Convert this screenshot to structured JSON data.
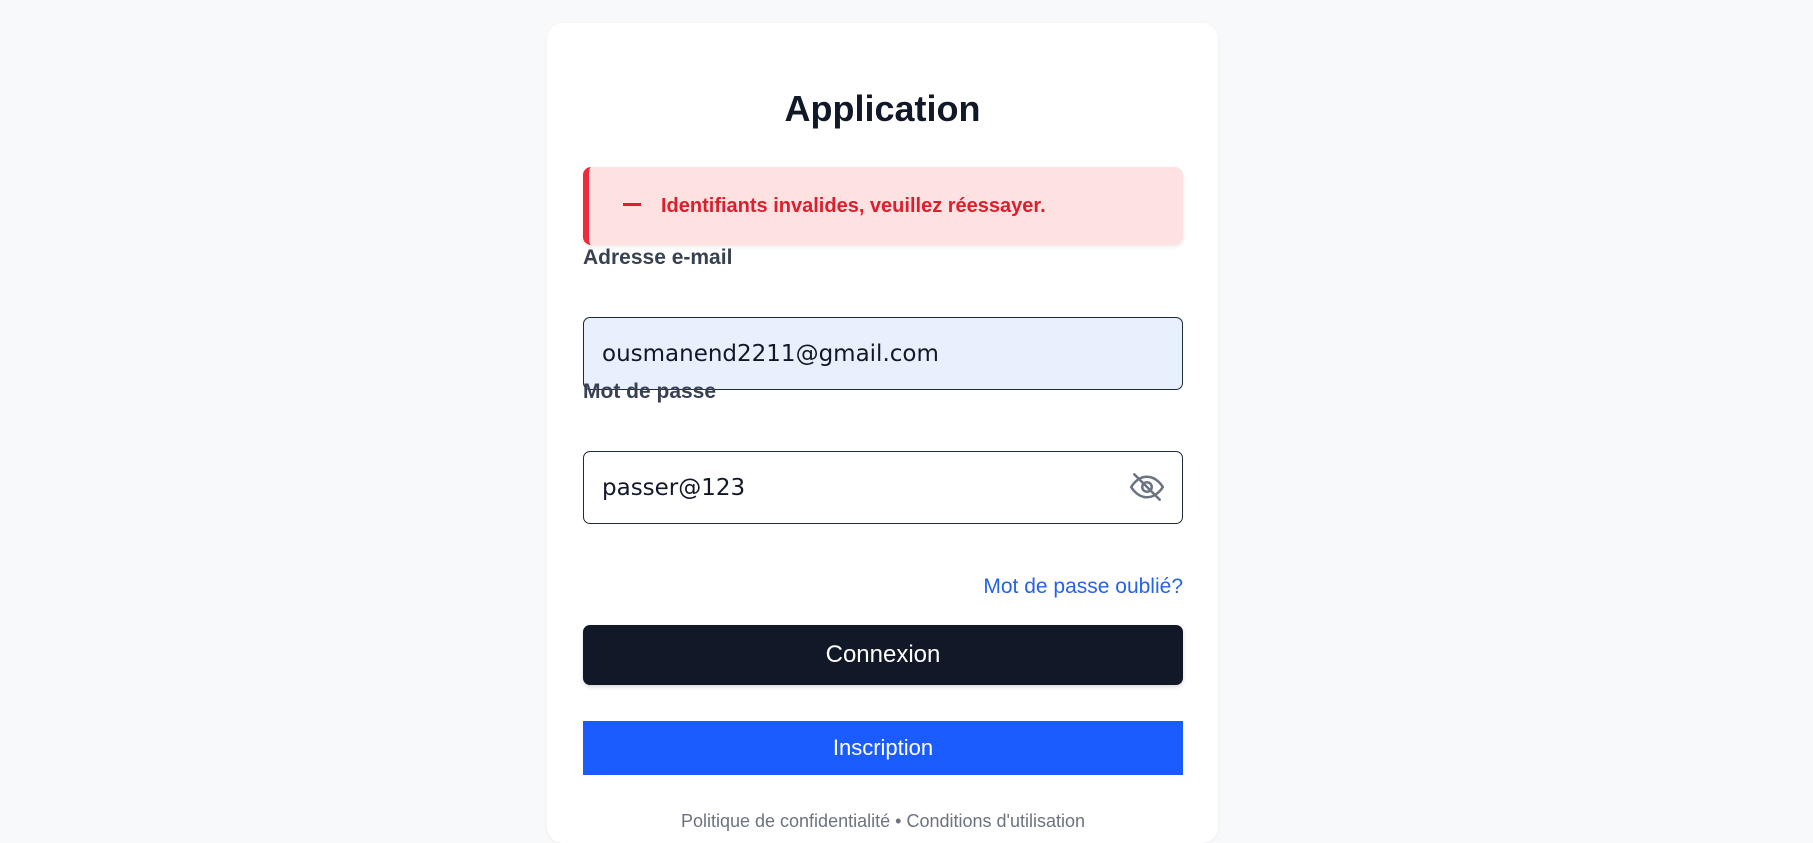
{
  "app": {
    "title": "Application"
  },
  "alert": {
    "message": "Identifiants invalides, veuillez réessayer.",
    "color": "#dc1f2c",
    "icon": "minus-icon"
  },
  "form": {
    "email": {
      "label": "Adresse e-mail",
      "value": "ousmanend2211@gmail.com"
    },
    "password": {
      "label": "Mot de passe",
      "value": "passer@123",
      "toggle_icon": "eye-off-icon"
    },
    "forgot_link": "Mot de passe oublié?",
    "submit_label": "Connexion",
    "register_label": "Inscription"
  },
  "footer": {
    "privacy": "Politique de confidentialité",
    "separator": "•",
    "terms": "Conditions d'utilisation"
  },
  "colors": {
    "primary_button": "#111827",
    "secondary_button": "#1a5cff",
    "link": "#2563eb",
    "alert_background": "#fee2e2"
  }
}
